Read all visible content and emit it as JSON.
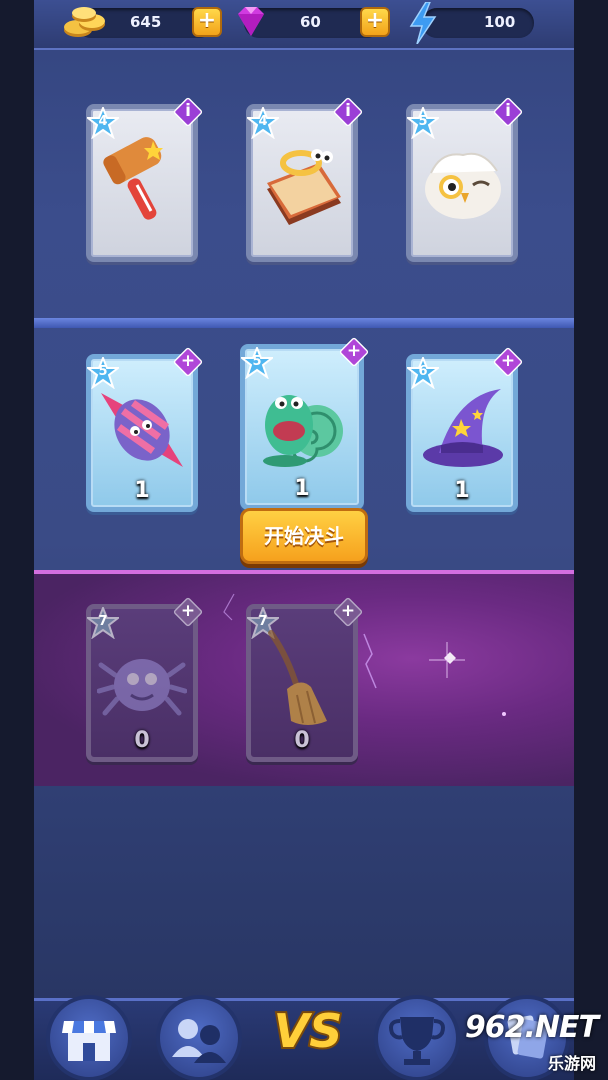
{
  "topbar": {
    "coins": "645",
    "gems": "60",
    "energy": "100"
  },
  "cards_top": [
    {
      "level": "4",
      "corner": "i",
      "item": "hammer"
    },
    {
      "level": "4",
      "corner": "i",
      "item": "spellbook"
    },
    {
      "level": "5",
      "corner": "i",
      "item": "owl"
    }
  ],
  "cards_mid": [
    {
      "level": "5",
      "corner": "+",
      "item": "candy",
      "count": "1"
    },
    {
      "level": "5",
      "corner": "+",
      "item": "snail",
      "count": "1"
    },
    {
      "level": "6",
      "corner": "+",
      "item": "wizard-hat",
      "count": "1"
    }
  ],
  "cards_low": [
    {
      "level": "7",
      "corner": "+",
      "item": "spider",
      "count": "0"
    },
    {
      "level": "7",
      "corner": "+",
      "item": "broom",
      "count": "0"
    }
  ],
  "start_button_label": "开始决斗",
  "bottom_nav": {
    "vs_label": "VS",
    "items": [
      "shop-icon",
      "friends-icon",
      "vs-icon",
      "trophy-icon",
      "cards-icon"
    ]
  },
  "watermark": {
    "top": "962.NET",
    "bottom": "乐游网"
  },
  "colors": {
    "accent_orange": "#f6a11d",
    "info_purple": "#9b3fd6",
    "plus_purple": "#b046d8",
    "level_blue": "#4fb6f0"
  }
}
